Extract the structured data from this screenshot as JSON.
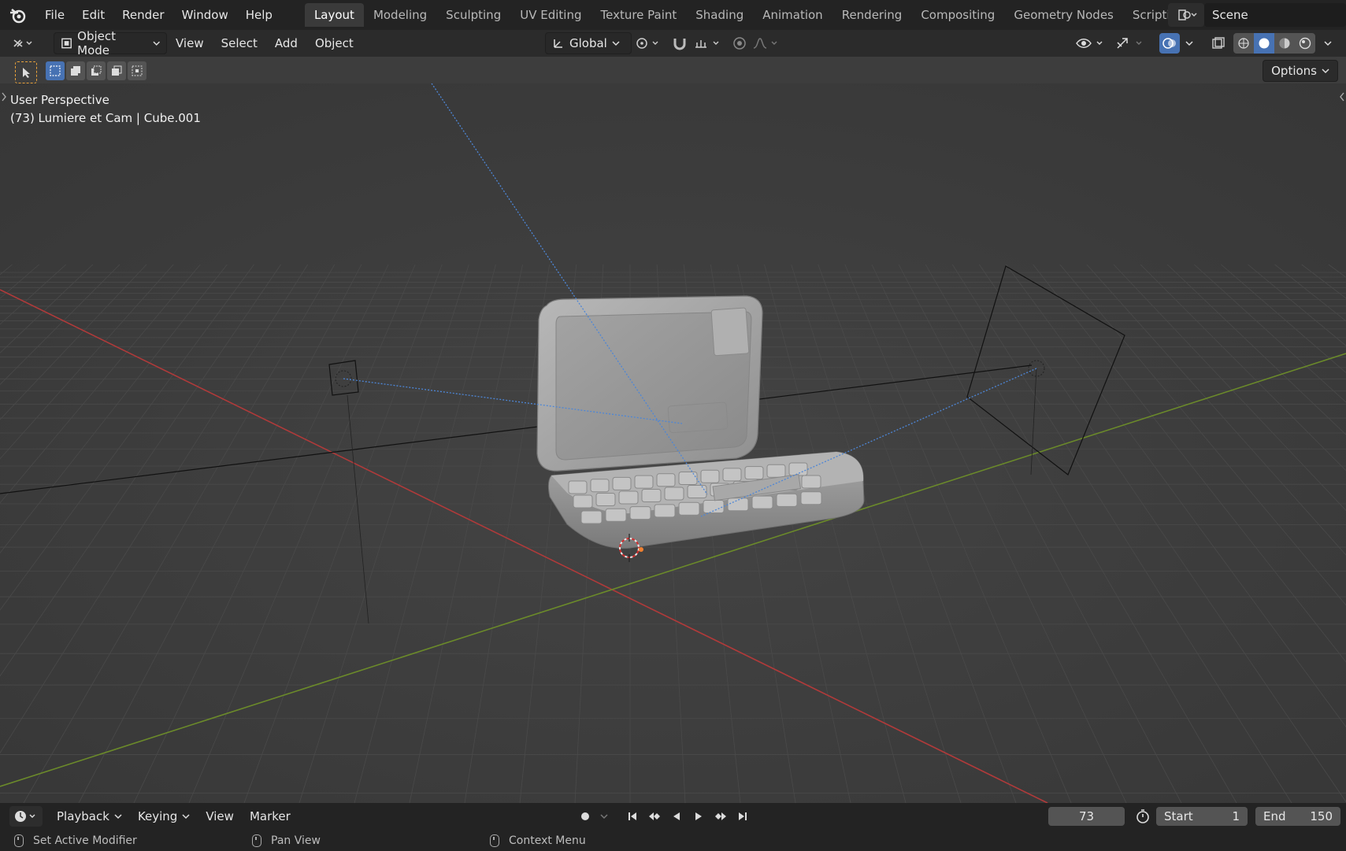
{
  "menu": [
    "File",
    "Edit",
    "Render",
    "Window",
    "Help"
  ],
  "workspaces": [
    {
      "label": "Layout",
      "active": true
    },
    {
      "label": "Modeling"
    },
    {
      "label": "Sculpting"
    },
    {
      "label": "UV Editing"
    },
    {
      "label": "Texture Paint"
    },
    {
      "label": "Shading"
    },
    {
      "label": "Animation"
    },
    {
      "label": "Rendering"
    },
    {
      "label": "Compositing"
    },
    {
      "label": "Geometry Nodes"
    },
    {
      "label": "Scripting"
    }
  ],
  "scene": {
    "name": "Scene"
  },
  "header": {
    "mode": "Object Mode",
    "view": "View",
    "select": "Select",
    "add": "Add",
    "object": "Object",
    "orientation": "Global"
  },
  "toolbar": {
    "options_label": "Options"
  },
  "viewport": {
    "perspective_label": "User Perspective",
    "object_label": "(73) Lumiere et Cam | Cube.001",
    "accent_x": "#b03a3a",
    "accent_y": "#6b8a2a",
    "light_line": "#4d86d6"
  },
  "timeline": {
    "playback": "Playback",
    "keying": "Keying",
    "view": "View",
    "marker": "Marker",
    "current_frame": "73",
    "start_label": "Start",
    "start_value": "1",
    "end_label": "End",
    "end_value": "150"
  },
  "status": {
    "left": "Set Active Modifier",
    "middle": "Pan View",
    "right": "Context Menu"
  }
}
